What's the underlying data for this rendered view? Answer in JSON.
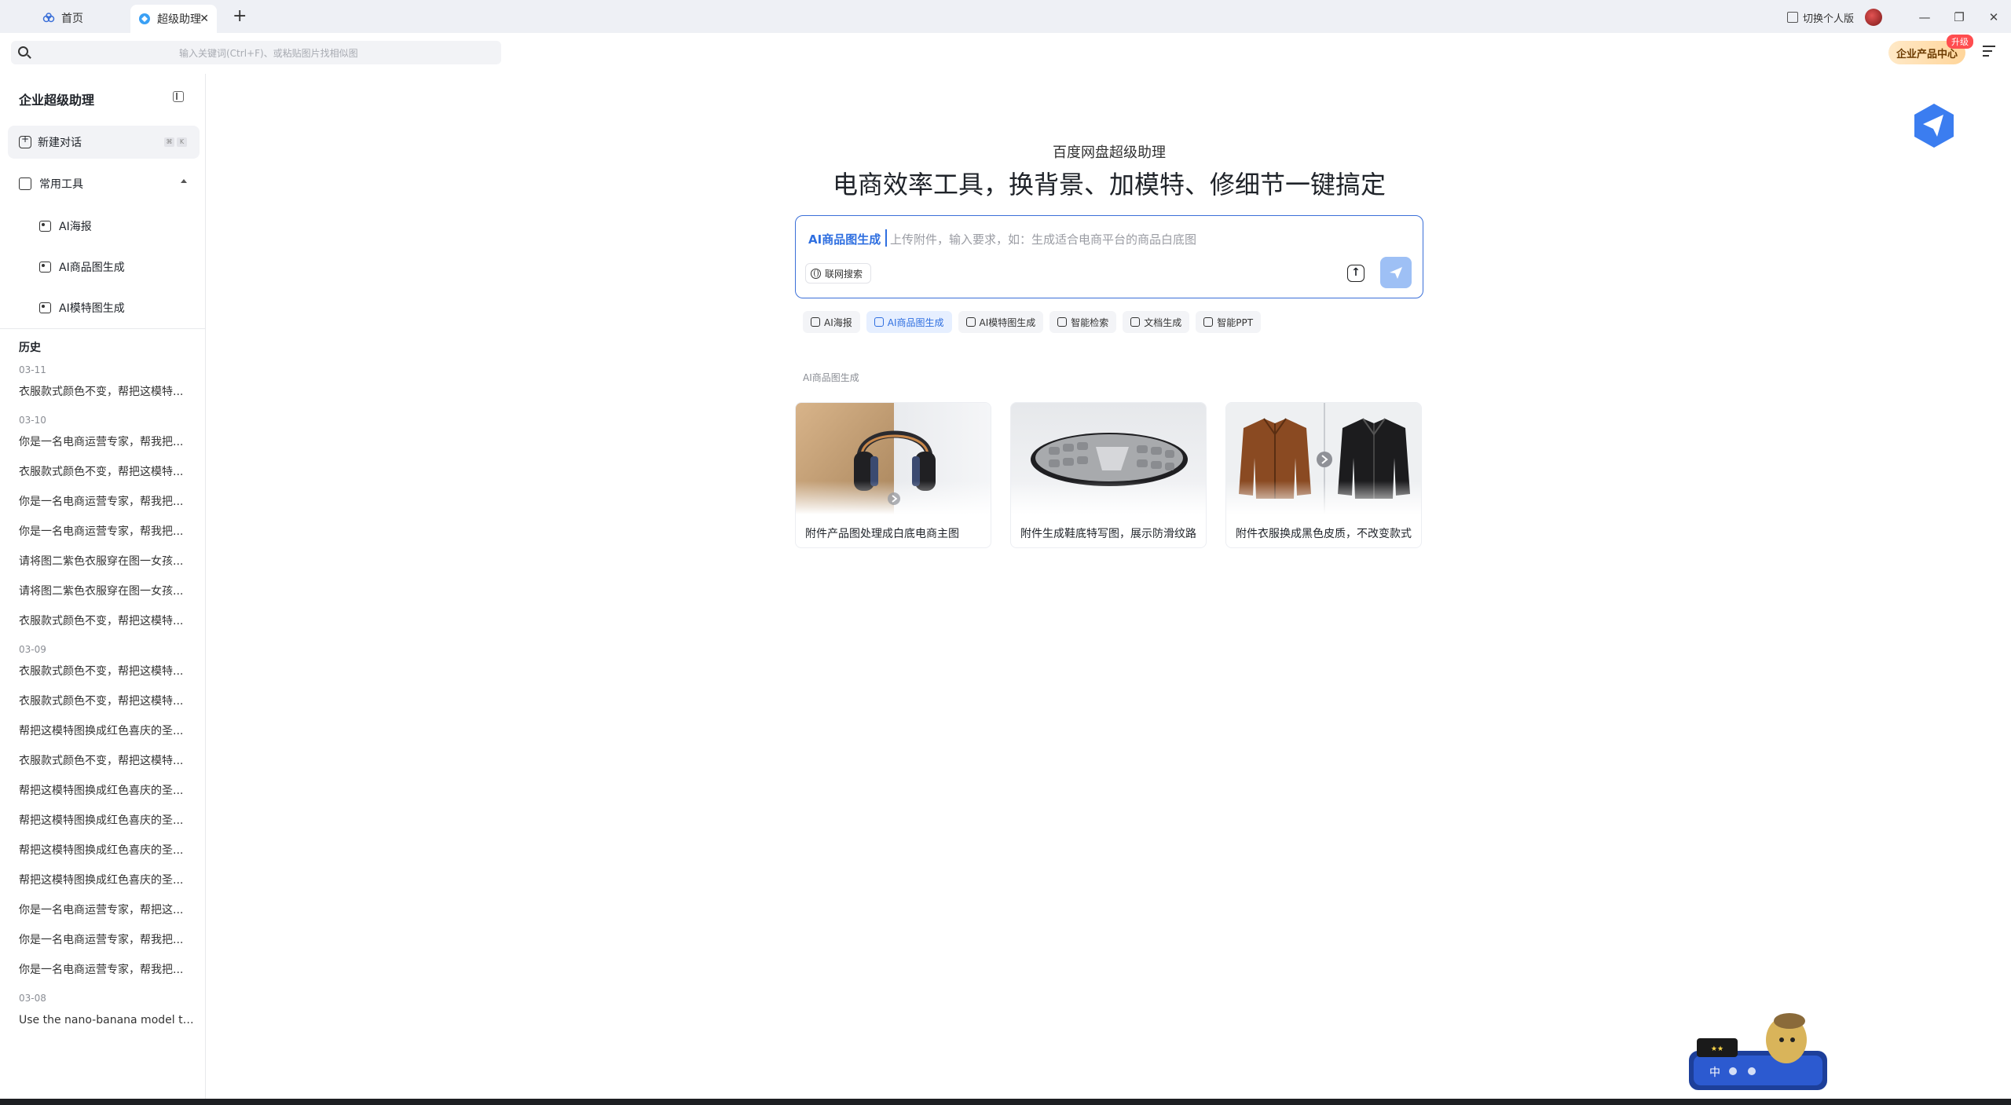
{
  "titlebar": {
    "tabs": [
      {
        "label": "首页",
        "icon": "app-home-icon"
      },
      {
        "label": "超级助理",
        "icon": "assistant-icon"
      }
    ],
    "switch_personal": "切换个人版",
    "window_controls": [
      "minimize-icon",
      "restore-icon",
      "close-icon"
    ]
  },
  "search": {
    "placeholder": "输入关键词(Ctrl+F)、或粘贴图片找相似图"
  },
  "header": {
    "biz_center": "企业产品中心",
    "upgrade_badge": "升级"
  },
  "sidebar": {
    "title": "企业超级助理",
    "new_chat": "新建对话",
    "shortcut_keys": [
      "⌘",
      "K"
    ],
    "tools_label": "常用工具",
    "tools": [
      "AI海报",
      "AI商品图生成",
      "AI模特图生成"
    ],
    "history_label": "历史",
    "history": [
      {
        "date": "03-11",
        "items": [
          "衣服款式颜色不变，帮把这模特..."
        ]
      },
      {
        "date": "03-10",
        "items": [
          "你是一名电商运营专家，帮我把...",
          "衣服款式颜色不变，帮把这模特...",
          "你是一名电商运营专家，帮我把...",
          "你是一名电商运营专家，帮我把...",
          "请将图二紫色衣服穿在图一女孩...",
          "请将图二紫色衣服穿在图一女孩...",
          "衣服款式颜色不变，帮把这模特..."
        ]
      },
      {
        "date": "03-09",
        "items": [
          "衣服款式颜色不变，帮把这模特...",
          "衣服款式颜色不变，帮把这模特...",
          "帮把这模特图换成红色喜庆的圣...",
          "衣服款式颜色不变，帮把这模特...",
          "帮把这模特图换成红色喜庆的圣...",
          "帮把这模特图换成红色喜庆的圣...",
          "帮把这模特图换成红色喜庆的圣...",
          "帮把这模特图换成红色喜庆的圣...",
          "你是一名电商运营专家，帮把这...",
          "你是一名电商运营专家，帮我把...",
          "你是一名电商运营专家，帮我把..."
        ]
      },
      {
        "date": "03-08",
        "items": [
          "Use the nano-banana model to..."
        ]
      }
    ]
  },
  "main": {
    "subtitle": "百度网盘超级助理",
    "headline": "电商效率工具，换背景、加模特、修细节一键搞定",
    "composer": {
      "mode": "AI商品图生成",
      "placeholder": "上传附件，输入要求，如：生成适合电商平台的商品白底图",
      "web_search": "联网搜索"
    },
    "chips": [
      {
        "label": "AI海报",
        "active": false
      },
      {
        "label": "AI商品图生成",
        "active": true
      },
      {
        "label": "AI模特图生成",
        "active": false
      },
      {
        "label": "智能检索",
        "active": false
      },
      {
        "label": "文档生成",
        "active": false
      },
      {
        "label": "智能PPT",
        "active": false
      }
    ],
    "section_label": "AI商品图生成",
    "cards": [
      {
        "caption": "附件产品图处理成白底电商主图",
        "image": "headphones"
      },
      {
        "caption": "附件生成鞋底特写图，展示防滑纹路",
        "image": "shoe-sole"
      },
      {
        "caption": "附件衣服换成黑色皮质，不改变款式",
        "image": "jackets"
      }
    ]
  },
  "colors": {
    "accent": "#2f6fe0",
    "send_button": "#9ec0f5",
    "sidebar_active_bg": "#f2f3f6"
  }
}
